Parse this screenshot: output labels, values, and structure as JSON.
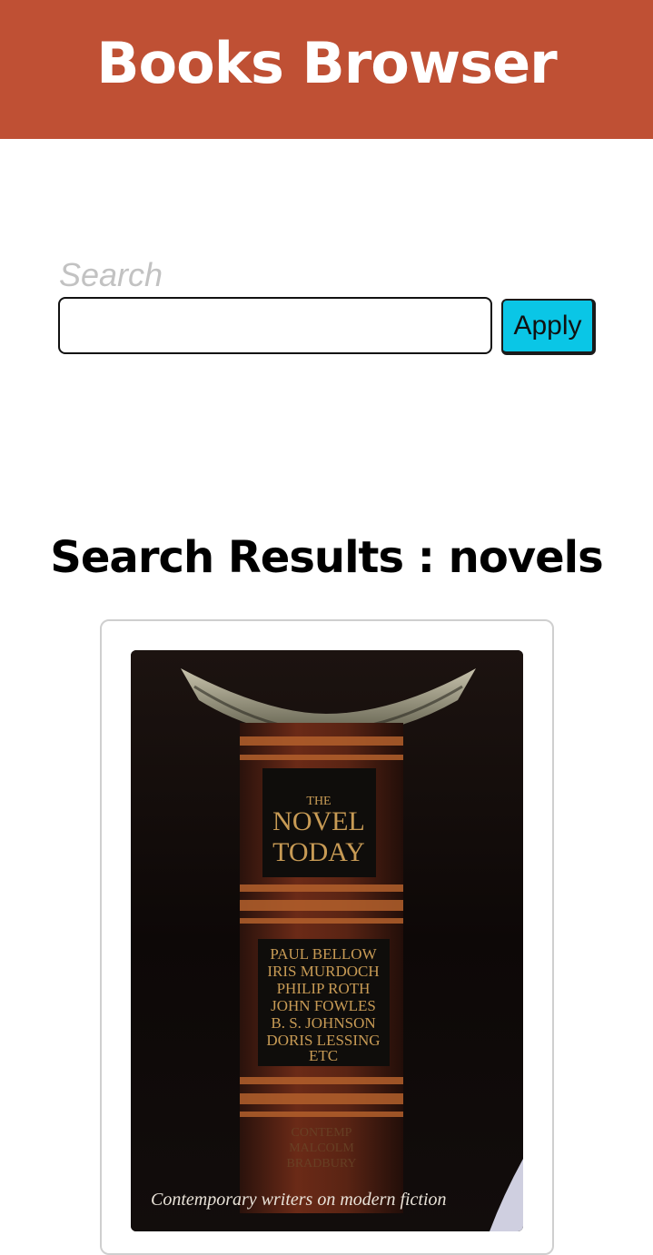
{
  "header": {
    "title": "Books Browser",
    "background_color": "#bf5034"
  },
  "search": {
    "label": "Search",
    "value": "",
    "placeholder": "",
    "apply_label": "Apply",
    "apply_color": "#0ac6e6"
  },
  "results": {
    "heading": "Search Results : novels",
    "books": [
      {
        "cover_title_line1": "THE",
        "cover_title_line2": "NOVEL",
        "cover_title_line3": "TODAY",
        "cover_authors": [
          "PAUL BELLOW",
          "IRIS MURDOCH",
          "PHILIP ROTH",
          "JOHN FOWLES",
          "B. S. JOHNSON",
          "DORIS LESSING",
          "ETC"
        ],
        "cover_tagline": "Contemporary writers on modern fiction"
      }
    ]
  }
}
